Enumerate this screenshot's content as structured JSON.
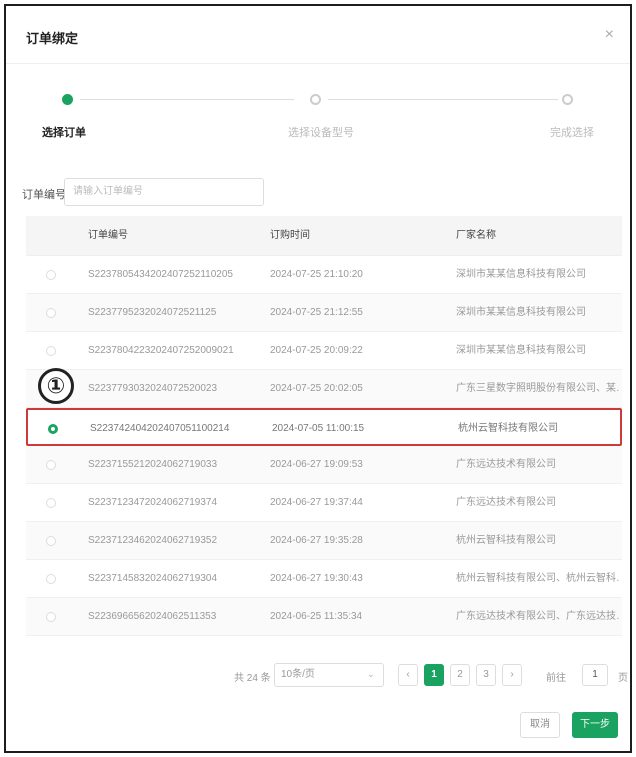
{
  "dialog": {
    "title": "订单绑定",
    "close_icon": "×"
  },
  "steps": [
    {
      "label": "选择订单",
      "active": true
    },
    {
      "label": "选择设备型号",
      "active": false
    },
    {
      "label": "完成选择",
      "active": false
    }
  ],
  "search": {
    "label": "订单编号",
    "placeholder": "请输入订单编号"
  },
  "table": {
    "headers": [
      "订单编号",
      "订购时间",
      "厂家名称"
    ],
    "rows": [
      {
        "order": "S2237805434202407252110205",
        "time": "2024-07-25 21:10:20",
        "vendor": "深圳市某某信息科技有限公司",
        "selected": false
      },
      {
        "order": "S2237795232024072521125",
        "time": "2024-07-25 21:12:55",
        "vendor": "深圳市某某信息科技有限公司",
        "selected": false
      },
      {
        "order": "S2237804223202407252009021",
        "time": "2024-07-25 20:09:22",
        "vendor": "深圳市某某信息科技有限公司",
        "selected": false
      },
      {
        "order": "S2237793032024072520023",
        "time": "2024-07-25 20:02:05",
        "vendor": "广东三星数字照明股份有限公司、某…",
        "selected": false
      },
      {
        "order": "S223742404202407051100214",
        "time": "2024-07-05 11:00:15",
        "vendor": "杭州云智科技有限公司",
        "selected": true
      },
      {
        "order": "S2237155212024062719033",
        "time": "2024-06-27 19:09:53",
        "vendor": "广东远达技术有限公司",
        "selected": false
      },
      {
        "order": "S2237123472024062719374",
        "time": "2024-06-27 19:37:44",
        "vendor": "广东远达技术有限公司",
        "selected": false
      },
      {
        "order": "S2237123462024062719352",
        "time": "2024-06-27 19:35:28",
        "vendor": "杭州云智科技有限公司",
        "selected": false
      },
      {
        "order": "S2237145832024062719304",
        "time": "2024-06-27 19:30:43",
        "vendor": "杭州云智科技有限公司、杭州云智科…",
        "selected": false
      },
      {
        "order": "S2236966562024062511353",
        "time": "2024-06-25 11:35:34",
        "vendor": "广东远达技术有限公司、广东远达技…",
        "selected": false
      }
    ]
  },
  "annotation": {
    "badge": "①"
  },
  "pagination": {
    "total": "共 24 条",
    "page_size": "10条/页",
    "prev": "‹",
    "pages": [
      "1",
      "2",
      "3"
    ],
    "current": "1",
    "next": "›",
    "goto_label": "前往",
    "goto_value": "1",
    "page_unit": "页"
  },
  "footer": {
    "cancel": "取消",
    "next": "下一步"
  },
  "colors": {
    "accent": "#1aa260",
    "highlight_border": "#cc3a3a"
  }
}
